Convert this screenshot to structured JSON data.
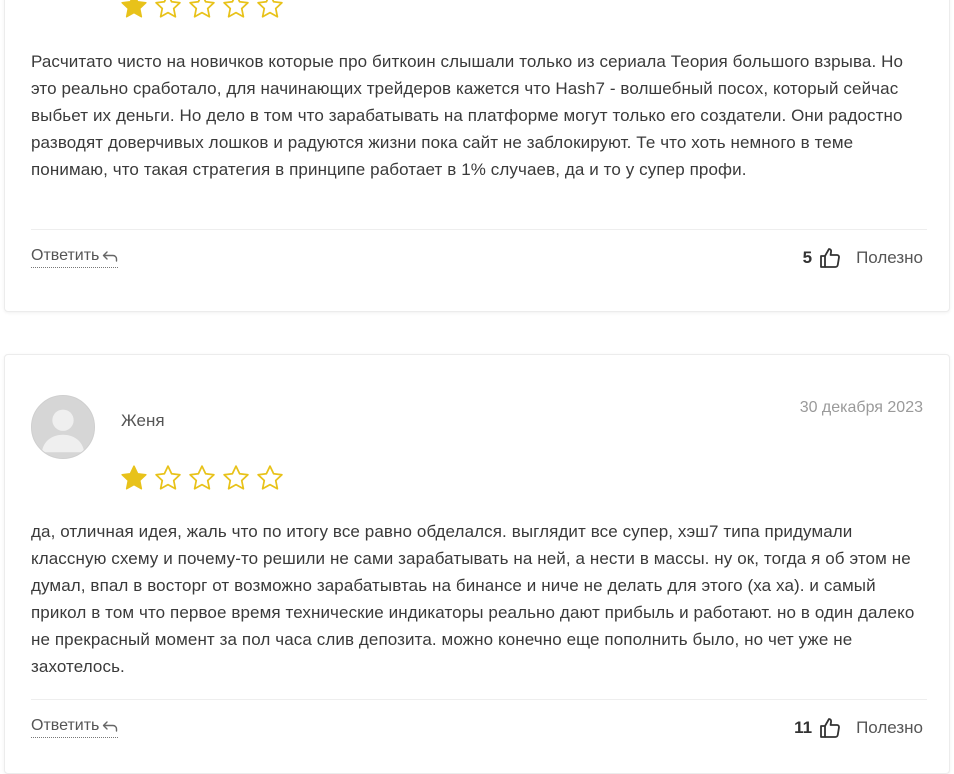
{
  "reviews": [
    {
      "rating": 1,
      "max_rating": 5,
      "text": "Расчитато чисто на новичков которые про биткоин слышали только из сериала Теория большого взрыва. Но это реально сработало, для начинающих трейдеров кажется что Hash7 - волшебный посох, который сейчас выбьет их деньги. Но дело в том что зарабатывать на платформе могут только его создатели. Они радостно разводят доверчивых лошков и радуются жизни пока сайт не заблокируют. Те что хоть немного в теме понимаю, что такая стратегия в принципе работает в 1% случаев, да и то у супер профи.",
      "reply_label": "Ответить",
      "votes": "5",
      "useful_label": "Полезно"
    },
    {
      "author": "Женя",
      "date": "30 декабря 2023",
      "rating": 1,
      "max_rating": 5,
      "text": "да, отличная идея, жаль что по итогу все равно обделался. выглядит все супер, хэш7 типа придумали классную схему и почему-то решили не сами зарабатывать на ней, а нести в массы. ну ок, тогда я об этом не думал, впал в восторг от возможно зарабатывтаь на бинансе и ниче не делать для этого (ха ха). и самый прикол в том что первое время технические индикаторы реально дают прибыль и работают. но в один далеко не прекрасный момент за пол часа слив депозита. можно конечно еще пополнить было, но чет уже не захотелось.",
      "reply_label": "Ответить",
      "votes": "11",
      "useful_label": "Полезно"
    }
  ],
  "colors": {
    "star_filled": "#E8C21A",
    "star_empty": "#E8C21A",
    "text": "#3a3a3a",
    "date": "#9a9a9a"
  },
  "icons": {
    "star": "star-icon",
    "reply": "reply-arrow-icon",
    "like": "thumbs-up-icon",
    "avatar": "user-avatar-icon"
  }
}
